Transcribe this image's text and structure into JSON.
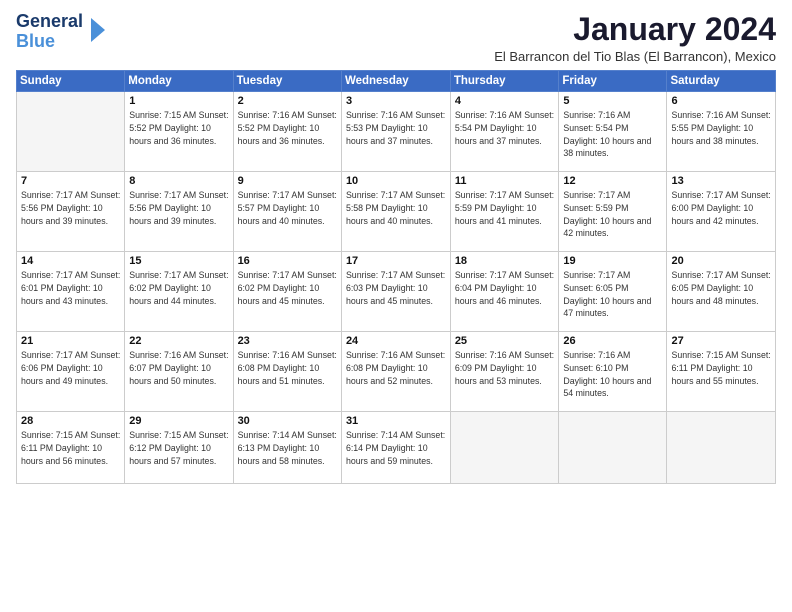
{
  "logo": {
    "general": "General",
    "blue": "Blue"
  },
  "header": {
    "month": "January 2024",
    "location": "El Barrancon del Tio Blas (El Barrancon), Mexico"
  },
  "weekdays": [
    "Sunday",
    "Monday",
    "Tuesday",
    "Wednesday",
    "Thursday",
    "Friday",
    "Saturday"
  ],
  "weeks": [
    [
      {
        "day": "",
        "info": ""
      },
      {
        "day": "1",
        "info": "Sunrise: 7:15 AM\nSunset: 5:52 PM\nDaylight: 10 hours\nand 36 minutes."
      },
      {
        "day": "2",
        "info": "Sunrise: 7:16 AM\nSunset: 5:52 PM\nDaylight: 10 hours\nand 36 minutes."
      },
      {
        "day": "3",
        "info": "Sunrise: 7:16 AM\nSunset: 5:53 PM\nDaylight: 10 hours\nand 37 minutes."
      },
      {
        "day": "4",
        "info": "Sunrise: 7:16 AM\nSunset: 5:54 PM\nDaylight: 10 hours\nand 37 minutes."
      },
      {
        "day": "5",
        "info": "Sunrise: 7:16 AM\nSunset: 5:54 PM\nDaylight: 10 hours\nand 38 minutes."
      },
      {
        "day": "6",
        "info": "Sunrise: 7:16 AM\nSunset: 5:55 PM\nDaylight: 10 hours\nand 38 minutes."
      }
    ],
    [
      {
        "day": "7",
        "info": "Sunrise: 7:17 AM\nSunset: 5:56 PM\nDaylight: 10 hours\nand 39 minutes."
      },
      {
        "day": "8",
        "info": "Sunrise: 7:17 AM\nSunset: 5:56 PM\nDaylight: 10 hours\nand 39 minutes."
      },
      {
        "day": "9",
        "info": "Sunrise: 7:17 AM\nSunset: 5:57 PM\nDaylight: 10 hours\nand 40 minutes."
      },
      {
        "day": "10",
        "info": "Sunrise: 7:17 AM\nSunset: 5:58 PM\nDaylight: 10 hours\nand 40 minutes."
      },
      {
        "day": "11",
        "info": "Sunrise: 7:17 AM\nSunset: 5:59 PM\nDaylight: 10 hours\nand 41 minutes."
      },
      {
        "day": "12",
        "info": "Sunrise: 7:17 AM\nSunset: 5:59 PM\nDaylight: 10 hours\nand 42 minutes."
      },
      {
        "day": "13",
        "info": "Sunrise: 7:17 AM\nSunset: 6:00 PM\nDaylight: 10 hours\nand 42 minutes."
      }
    ],
    [
      {
        "day": "14",
        "info": "Sunrise: 7:17 AM\nSunset: 6:01 PM\nDaylight: 10 hours\nand 43 minutes."
      },
      {
        "day": "15",
        "info": "Sunrise: 7:17 AM\nSunset: 6:02 PM\nDaylight: 10 hours\nand 44 minutes."
      },
      {
        "day": "16",
        "info": "Sunrise: 7:17 AM\nSunset: 6:02 PM\nDaylight: 10 hours\nand 45 minutes."
      },
      {
        "day": "17",
        "info": "Sunrise: 7:17 AM\nSunset: 6:03 PM\nDaylight: 10 hours\nand 45 minutes."
      },
      {
        "day": "18",
        "info": "Sunrise: 7:17 AM\nSunset: 6:04 PM\nDaylight: 10 hours\nand 46 minutes."
      },
      {
        "day": "19",
        "info": "Sunrise: 7:17 AM\nSunset: 6:05 PM\nDaylight: 10 hours\nand 47 minutes."
      },
      {
        "day": "20",
        "info": "Sunrise: 7:17 AM\nSunset: 6:05 PM\nDaylight: 10 hours\nand 48 minutes."
      }
    ],
    [
      {
        "day": "21",
        "info": "Sunrise: 7:17 AM\nSunset: 6:06 PM\nDaylight: 10 hours\nand 49 minutes."
      },
      {
        "day": "22",
        "info": "Sunrise: 7:16 AM\nSunset: 6:07 PM\nDaylight: 10 hours\nand 50 minutes."
      },
      {
        "day": "23",
        "info": "Sunrise: 7:16 AM\nSunset: 6:08 PM\nDaylight: 10 hours\nand 51 minutes."
      },
      {
        "day": "24",
        "info": "Sunrise: 7:16 AM\nSunset: 6:08 PM\nDaylight: 10 hours\nand 52 minutes."
      },
      {
        "day": "25",
        "info": "Sunrise: 7:16 AM\nSunset: 6:09 PM\nDaylight: 10 hours\nand 53 minutes."
      },
      {
        "day": "26",
        "info": "Sunrise: 7:16 AM\nSunset: 6:10 PM\nDaylight: 10 hours\nand 54 minutes."
      },
      {
        "day": "27",
        "info": "Sunrise: 7:15 AM\nSunset: 6:11 PM\nDaylight: 10 hours\nand 55 minutes."
      }
    ],
    [
      {
        "day": "28",
        "info": "Sunrise: 7:15 AM\nSunset: 6:11 PM\nDaylight: 10 hours\nand 56 minutes."
      },
      {
        "day": "29",
        "info": "Sunrise: 7:15 AM\nSunset: 6:12 PM\nDaylight: 10 hours\nand 57 minutes."
      },
      {
        "day": "30",
        "info": "Sunrise: 7:14 AM\nSunset: 6:13 PM\nDaylight: 10 hours\nand 58 minutes."
      },
      {
        "day": "31",
        "info": "Sunrise: 7:14 AM\nSunset: 6:14 PM\nDaylight: 10 hours\nand 59 minutes."
      },
      {
        "day": "",
        "info": ""
      },
      {
        "day": "",
        "info": ""
      },
      {
        "day": "",
        "info": ""
      }
    ]
  ]
}
